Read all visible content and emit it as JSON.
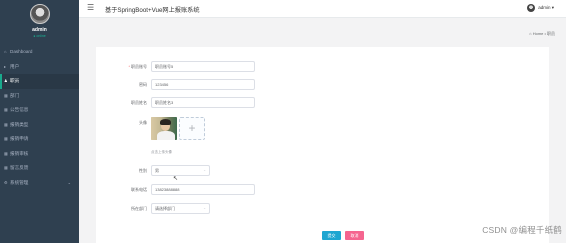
{
  "profile": {
    "name": "admin",
    "status": "● online"
  },
  "sidebar": {
    "items": [
      {
        "icon": "home-icon",
        "glyph": "⌂",
        "label": "Dashboard",
        "active": false,
        "chevron": ""
      },
      {
        "icon": "caret-right-icon",
        "glyph": "▸",
        "label": "用户",
        "active": false,
        "chevron": ""
      },
      {
        "icon": "user-icon",
        "glyph": "♟",
        "label": "职员",
        "active": true,
        "chevron": ""
      },
      {
        "icon": "grid-icon",
        "glyph": "▦",
        "label": "部门",
        "active": false,
        "chevron": ""
      },
      {
        "icon": "grid-icon",
        "glyph": "▦",
        "label": "公告信息",
        "active": false,
        "chevron": ""
      },
      {
        "icon": "grid-icon",
        "glyph": "▦",
        "label": "报销类型",
        "active": false,
        "chevron": ""
      },
      {
        "icon": "grid-icon",
        "glyph": "▦",
        "label": "报销申请",
        "active": false,
        "chevron": ""
      },
      {
        "icon": "grid-icon",
        "glyph": "▦",
        "label": "报销审核",
        "active": false,
        "chevron": ""
      },
      {
        "icon": "grid-icon",
        "glyph": "▦",
        "label": "留言反馈",
        "active": false,
        "chevron": ""
      },
      {
        "icon": "settings-icon",
        "glyph": "⚙",
        "label": "系统管理",
        "active": false,
        "chevron": "⌄"
      }
    ]
  },
  "header": {
    "title": "基于SpringBoot+Vue网上报账系统",
    "user": "admin ▾",
    "menu_glyph": "☰"
  },
  "breadcrumb": {
    "home": "⌂ Home",
    "sep": " • ",
    "current": "职员"
  },
  "form": {
    "account": {
      "label": "职员账号",
      "required": "*",
      "value": "职员账号5"
    },
    "password": {
      "label": "密码",
      "value": "123456"
    },
    "name": {
      "label": "职员姓名",
      "value": "职员姓名3"
    },
    "avatar": {
      "label": "头像",
      "plus": "+",
      "hint": "点击上传头像"
    },
    "gender": {
      "label": "性别",
      "value": "男",
      "arrow": "⌄"
    },
    "phone": {
      "label": "联系电话",
      "value": "13823888888"
    },
    "dept": {
      "label": "所在部门",
      "value": "请选择部门",
      "arrow": "⌄"
    }
  },
  "buttons": {
    "submit": "提交",
    "cancel": "取消"
  },
  "watermark": "CSDN @编程千纸鹤"
}
